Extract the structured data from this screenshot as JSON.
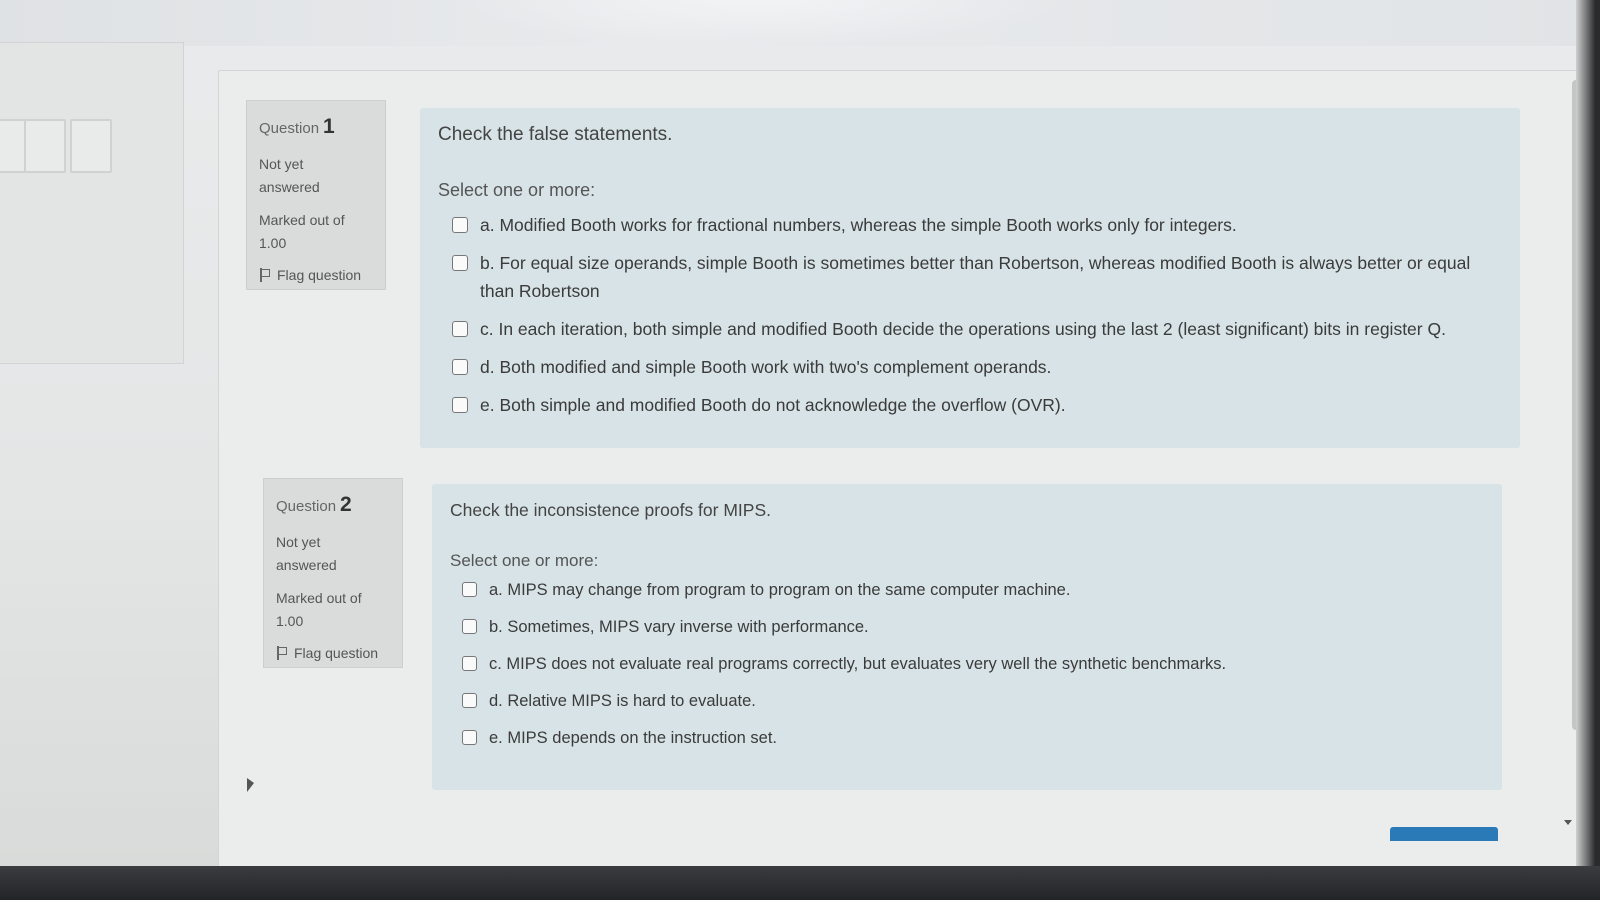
{
  "questions": [
    {
      "label": "Question",
      "number": "1",
      "state_line1": "Not yet",
      "state_line2": "answered",
      "marked_line1": "Marked out of",
      "marked_line2": "1.00",
      "flag_label": "Flag question",
      "text": "Check the false statements.",
      "prompt": "Select one or more:",
      "options": [
        "a. Modified Booth works for fractional numbers, whereas the simple Booth works only for integers.",
        "b. For equal size operands, simple Booth is sometimes better than Robertson, whereas modified Booth is always better or equal than Robertson",
        "c. In each iteration, both simple and modified Booth decide the operations using the last 2 (least significant) bits in register Q.",
        "d. Both modified and simple Booth work with two's complement operands.",
        "e. Both simple and modified Booth do not acknowledge the overflow (OVR)."
      ]
    },
    {
      "label": "Question",
      "number": "2",
      "state_line1": "Not yet",
      "state_line2": "answered",
      "marked_line1": "Marked out of",
      "marked_line2": "1.00",
      "flag_label": "Flag question",
      "text": "Check the inconsistence proofs for MIPS.",
      "prompt": "Select one or more:",
      "options": [
        "a. MIPS may change from program to program on the same computer machine.",
        "b. Sometimes, MIPS vary inverse with performance.",
        "c. MIPS does not evaluate real programs correctly, but evaluates very well the synthetic benchmarks.",
        "d. Relative MIPS is hard to evaluate.",
        "e. MIPS depends on the instruction set."
      ]
    }
  ],
  "icons": {
    "flag": "flag-icon",
    "checkbox": "checkbox-icon"
  },
  "colors": {
    "content_bg": "#d7e3e6",
    "info_bg": "#dadcdc",
    "next_button": "#2a7ab8"
  }
}
